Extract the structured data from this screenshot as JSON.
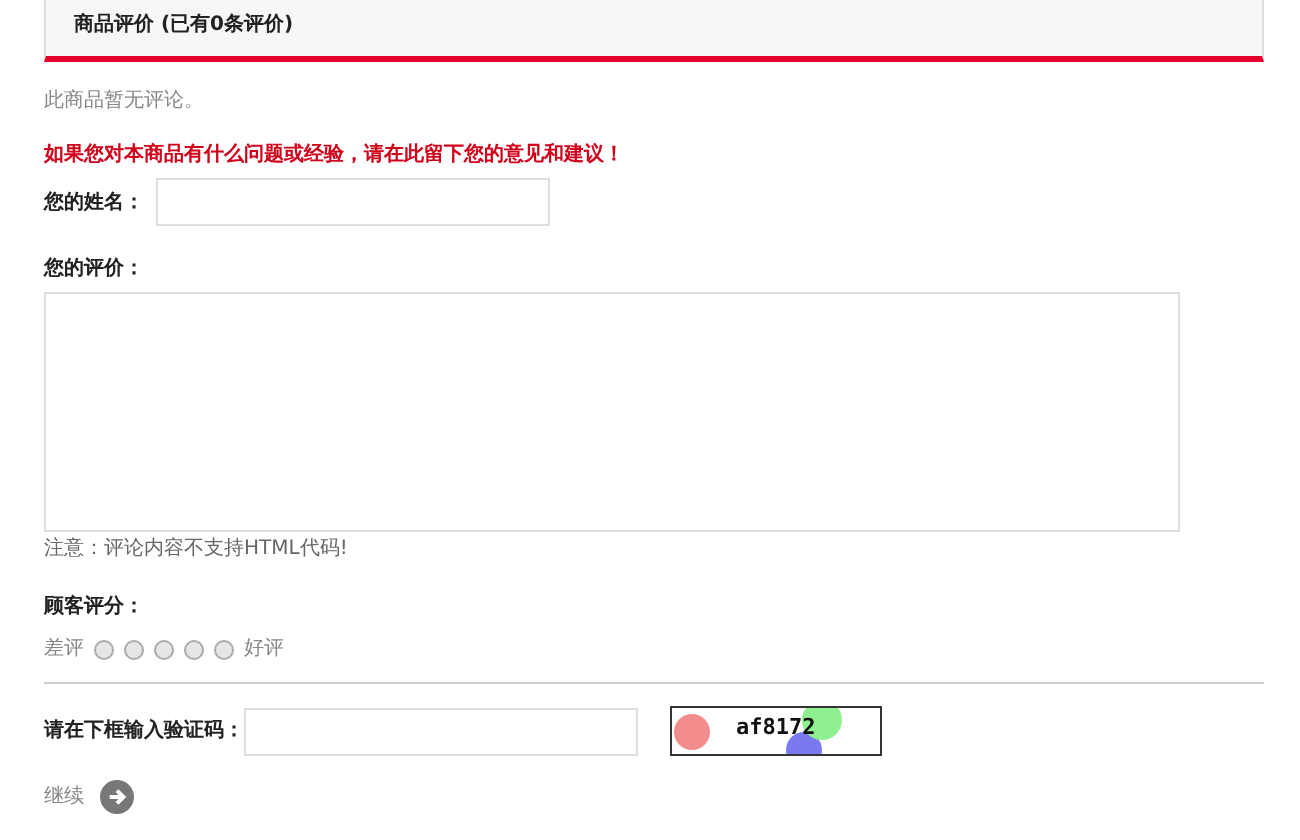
{
  "header": {
    "title": "商品评价 (已有0条评价)"
  },
  "no_reviews": "此商品暂无评论。",
  "prompt": "如果您对本商品有什么问题或经验，请在此留下您的意见和建议！",
  "name_field": {
    "label": "您的姓名："
  },
  "review_field": {
    "label": "您的评价："
  },
  "note": "注意：评论内容不支持HTML代码!",
  "rating": {
    "label": "顾客评分：",
    "low_label": "差评",
    "high_label": "好评",
    "options": [
      {
        "selected": false
      },
      {
        "selected": false
      },
      {
        "selected": false
      },
      {
        "selected": false
      },
      {
        "selected": false
      }
    ]
  },
  "captcha": {
    "label": "请在下框输入验证码：",
    "code": "af8172"
  },
  "continue": {
    "label": "继续"
  }
}
